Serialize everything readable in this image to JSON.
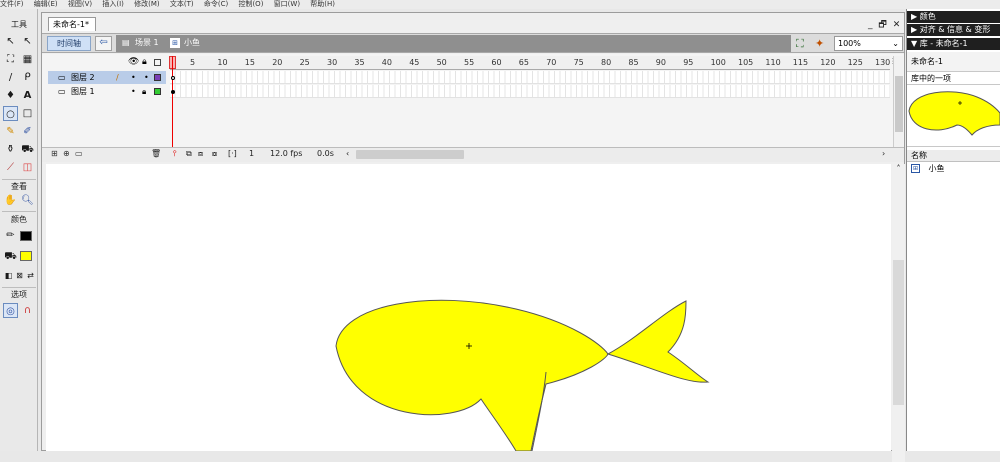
{
  "menu": [
    "文件(F)",
    "编辑(E)",
    "视图(V)",
    "插入(I)",
    "修改(M)",
    "文本(T)",
    "命令(C)",
    "控制(O)",
    "窗口(W)",
    "帮助(H)"
  ],
  "toolbox": {
    "title": "工具",
    "view_label": "查看",
    "color_label": "颜色",
    "options_label": "选项",
    "stroke_color": "#000000",
    "fill_color": "#ffff00"
  },
  "document": {
    "tab_label": "未命名-1*"
  },
  "window_controls": {
    "minimize": "_",
    "restore": "🗗",
    "close": "✕"
  },
  "editbar": {
    "timeline_button": "时间轴",
    "scene_label": "场景 1",
    "symbol_label": "小鱼",
    "zoom": "100%"
  },
  "timeline": {
    "layers": [
      {
        "name": "图层 2",
        "color": "#7a3fb8",
        "selected": true
      },
      {
        "name": "图层 1",
        "color": "#33cc33",
        "selected": false
      }
    ],
    "frame_ticks": [
      "5",
      "10",
      "15",
      "20",
      "25",
      "30",
      "35",
      "40",
      "45",
      "50",
      "55",
      "60",
      "65",
      "70",
      "75",
      "80",
      "85",
      "90",
      "95",
      "100",
      "105",
      "110",
      "115",
      "120",
      "125",
      "130"
    ],
    "current_frame": "1",
    "fps": "12.0 fps",
    "elapsed": "0.0s"
  },
  "panels": {
    "color_header": "▶ 颜色",
    "align_header": "▶ 对齐 & 信息 & 变形",
    "library_header": "▼ 库 - 未命名-1"
  },
  "library": {
    "doc_name": "未命名-1",
    "item_count": "库中的一项",
    "column_name": "名称",
    "items": [
      {
        "name": "小鱼",
        "icon": "graphic-symbol-icon"
      }
    ]
  },
  "stage": {
    "fish_fill": "#ffff00",
    "fish_stroke": "#555555"
  }
}
